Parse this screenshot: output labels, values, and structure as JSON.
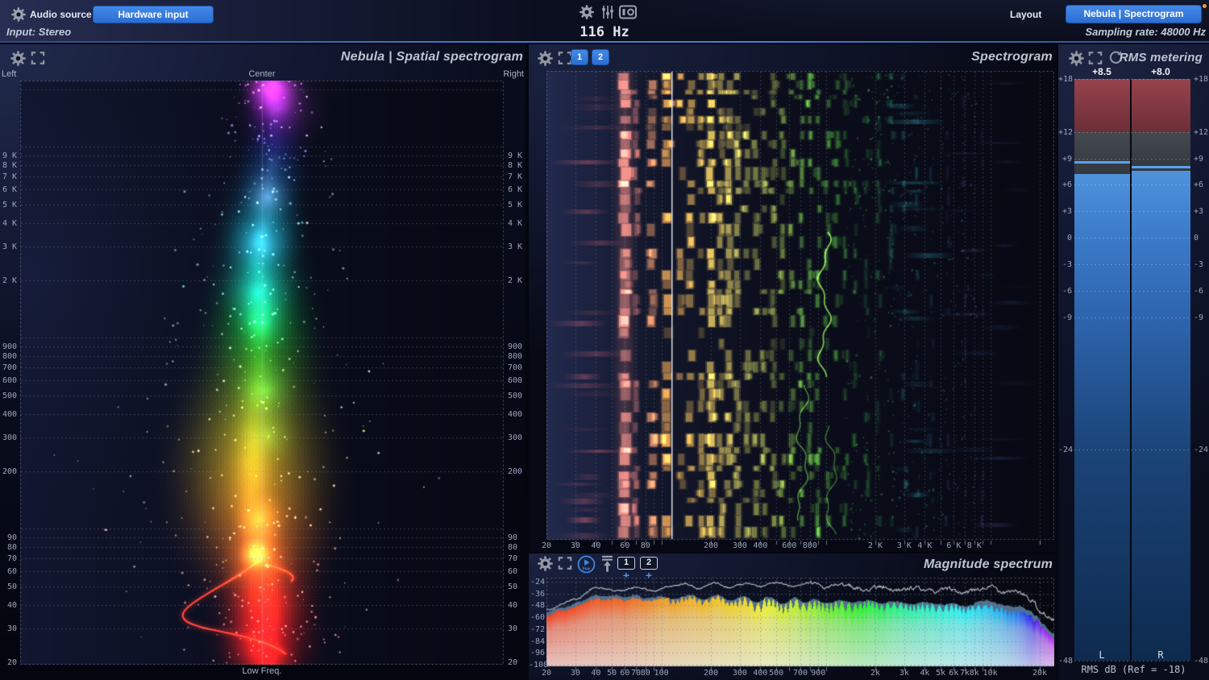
{
  "topbar": {
    "audio_source_label": "Audio source",
    "hardware_input_button": "Hardware input",
    "input_status": "Input: Stereo",
    "frequency_readout": "116 Hz",
    "layout_label": "Layout",
    "layout_button": "Nebula | Spectrogram",
    "sampling_rate": "Sampling rate: 48000 Hz"
  },
  "spatial_panel": {
    "title": "Nebula | Spatial spectrogram",
    "top_left_label": "Left",
    "top_center_label": "Center",
    "top_right_label": "Right",
    "bottom_label": "Low Freq.",
    "freq_labels": [
      {
        "f": 9000,
        "t": "9 K"
      },
      {
        "f": 8000,
        "t": "8 K"
      },
      {
        "f": 7000,
        "t": "7 K"
      },
      {
        "f": 6000,
        "t": "6 K"
      },
      {
        "f": 5000,
        "t": "5 K"
      },
      {
        "f": 4000,
        "t": "4 K"
      },
      {
        "f": 3000,
        "t": "3 K"
      },
      {
        "f": 2000,
        "t": "2 K"
      },
      {
        "f": 900,
        "t": "900"
      },
      {
        "f": 800,
        "t": "800"
      },
      {
        "f": 700,
        "t": "700"
      },
      {
        "f": 600,
        "t": "600"
      },
      {
        "f": 500,
        "t": "500"
      },
      {
        "f": 400,
        "t": "400"
      },
      {
        "f": 300,
        "t": "300"
      },
      {
        "f": 200,
        "t": "200"
      },
      {
        "f": 90,
        "t": "90"
      },
      {
        "f": 80,
        "t": "80"
      },
      {
        "f": 70,
        "t": "70"
      },
      {
        "f": 60,
        "t": "60"
      },
      {
        "f": 50,
        "t": "50"
      },
      {
        "f": 40,
        "t": "40"
      },
      {
        "f": 30,
        "t": "30"
      },
      {
        "f": 20,
        "t": "20"
      }
    ]
  },
  "spectrogram_panel": {
    "title": "Spectrogram",
    "button_1": "1",
    "button_2": "2",
    "cursor_freq_hz": 116,
    "freq_labels": [
      {
        "f": 20,
        "t": "20"
      },
      {
        "f": 30,
        "t": "30"
      },
      {
        "f": 40,
        "t": "40"
      },
      {
        "f": 60,
        "t": "60"
      },
      {
        "f": 80,
        "t": "80"
      },
      {
        "f": 200,
        "t": "200"
      },
      {
        "f": 300,
        "t": "300"
      },
      {
        "f": 400,
        "t": "400"
      },
      {
        "f": 600,
        "t": "600"
      },
      {
        "f": 800,
        "t": "800"
      },
      {
        "f": 2000,
        "t": "2 K"
      },
      {
        "f": 3000,
        "t": "3 K"
      },
      {
        "f": 4000,
        "t": "4 K"
      },
      {
        "f": 6000,
        "t": "6 K"
      },
      {
        "f": 8000,
        "t": "8 K"
      }
    ]
  },
  "magnitude_panel": {
    "title": "Magnitude spectrum",
    "live_label": "live",
    "snapshot_1": "1",
    "snapshot_2": "2",
    "db_labels": [
      {
        "db": -24,
        "t": "-24"
      },
      {
        "db": -36,
        "t": "-36"
      },
      {
        "db": -48,
        "t": "-48"
      },
      {
        "db": -60,
        "t": "-60"
      },
      {
        "db": -72,
        "t": "-72"
      },
      {
        "db": -84,
        "t": "-84"
      },
      {
        "db": -96,
        "t": "-96"
      },
      {
        "db": -108,
        "t": "-108"
      }
    ],
    "freq_labels": [
      {
        "f": 20,
        "t": "20"
      },
      {
        "f": 30,
        "t": "30"
      },
      {
        "f": 40,
        "t": "40"
      },
      {
        "f": 50,
        "t": "50"
      },
      {
        "f": 60,
        "t": "60"
      },
      {
        "f": 70,
        "t": "70"
      },
      {
        "f": 80,
        "t": "80"
      },
      {
        "f": 100,
        "t": "100"
      },
      {
        "f": 200,
        "t": "200"
      },
      {
        "f": 300,
        "t": "300"
      },
      {
        "f": 400,
        "t": "400"
      },
      {
        "f": 500,
        "t": "500"
      },
      {
        "f": 700,
        "t": "700"
      },
      {
        "f": 900,
        "t": "900"
      },
      {
        "f": 2000,
        "t": "2k"
      },
      {
        "f": 3000,
        "t": "3k"
      },
      {
        "f": 4000,
        "t": "4k"
      },
      {
        "f": 5000,
        "t": "5k"
      },
      {
        "f": 6000,
        "t": "6k"
      },
      {
        "f": 7000,
        "t": "7k"
      },
      {
        "f": 8000,
        "t": "8k"
      },
      {
        "f": 10000,
        "t": "10k"
      },
      {
        "f": 20000,
        "t": "20k"
      }
    ]
  },
  "rms_panel": {
    "title": "RMS metering",
    "scale_labels": [
      {
        "db": 18,
        "t": "+18"
      },
      {
        "db": 12,
        "t": "+12"
      },
      {
        "db": 9,
        "t": "+9"
      },
      {
        "db": 6,
        "t": "+6"
      },
      {
        "db": 3,
        "t": "+3"
      },
      {
        "db": 0,
        "t": "0"
      },
      {
        "db": -3,
        "t": "-3"
      },
      {
        "db": -6,
        "t": "-6"
      },
      {
        "db": -9,
        "t": "-9"
      },
      {
        "db": -24,
        "t": "-24"
      },
      {
        "db": -48,
        "t": "-48"
      }
    ],
    "meters": [
      {
        "name": "L",
        "value_label": "+8.5",
        "value_db": 8.5,
        "fill_db": 7.2
      },
      {
        "name": "R",
        "value_label": "+8.0",
        "value_db": 8.0,
        "fill_db": 7.6
      }
    ],
    "footer": "RMS dB (Ref = -18)"
  },
  "colors": {
    "accent_blue": "#3b7de0",
    "meter_red_top": "#97434c",
    "meter_red_bottom": "#6d2e38",
    "meter_gray_top": "#44484f",
    "meter_gray_bottom": "#34383f",
    "meter_marker": "#57a3f2",
    "meter_blue_top": "#4e92dc",
    "meter_blue_mid": "#2d65ae",
    "meter_blue_low": "#1b4478",
    "meter_blue_bottom": "#0e2a4e",
    "orange_dot": "#e8a030"
  }
}
